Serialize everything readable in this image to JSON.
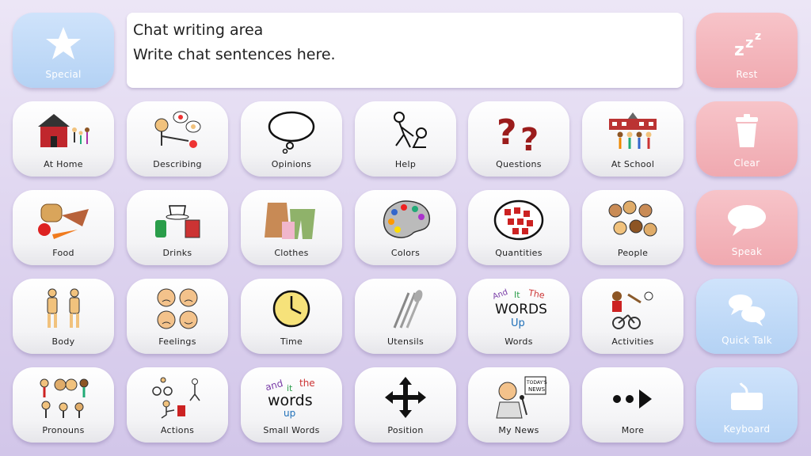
{
  "chat": {
    "line1": "Chat writing area",
    "line2": "Write chat sentences here."
  },
  "left": {
    "special": {
      "label": "Special",
      "icon": "star-icon"
    }
  },
  "right": {
    "rest": {
      "label": "Rest",
      "icon": "zzz-icon"
    },
    "clear": {
      "label": "Clear",
      "icon": "trash-icon"
    },
    "speak": {
      "label": "Speak",
      "icon": "speech-bubble-icon"
    },
    "quick_talk": {
      "label": "Quick Talk",
      "icon": "chat-bubbles-icon"
    },
    "keyboard": {
      "label": "Keyboard",
      "icon": "keyboard-icon"
    }
  },
  "grid": [
    {
      "label": "At Home",
      "icon": "home-family-icon"
    },
    {
      "label": "Describing",
      "icon": "describing-icon"
    },
    {
      "label": "Opinions",
      "icon": "thought-bubble-icon"
    },
    {
      "label": "Help",
      "icon": "help-people-icon"
    },
    {
      "label": "Questions",
      "icon": "question-marks-icon"
    },
    {
      "label": "At School",
      "icon": "school-icon"
    },
    {
      "label": "Food",
      "icon": "food-icon"
    },
    {
      "label": "Drinks",
      "icon": "drinks-icon"
    },
    {
      "label": "Clothes",
      "icon": "clothes-icon"
    },
    {
      "label": "Colors",
      "icon": "palette-icon"
    },
    {
      "label": "Quantities",
      "icon": "quantities-icon"
    },
    {
      "label": "People",
      "icon": "people-faces-icon"
    },
    {
      "label": "Body",
      "icon": "body-icon"
    },
    {
      "label": "Feelings",
      "icon": "feelings-faces-icon"
    },
    {
      "label": "Time",
      "icon": "clock-icon"
    },
    {
      "label": "Utensils",
      "icon": "utensils-icon"
    },
    {
      "label": "Words",
      "icon": "words-icon"
    },
    {
      "label": "Activities",
      "icon": "activities-icon"
    },
    {
      "label": "Pronouns",
      "icon": "pronouns-icon"
    },
    {
      "label": "Actions",
      "icon": "actions-icon"
    },
    {
      "label": "Small Words",
      "icon": "small-words-icon"
    },
    {
      "label": "Position",
      "icon": "move-arrows-icon"
    },
    {
      "label": "My News",
      "icon": "news-reader-icon"
    },
    {
      "label": "More",
      "icon": "more-arrow-icon"
    }
  ],
  "words_tile_text": {
    "and": "And",
    "it": "It",
    "the": "The",
    "words": "WORDS",
    "up": "Up"
  },
  "small_words_tile_text": {
    "and": "and",
    "it": "it",
    "the": "the",
    "words": "words",
    "up": "up"
  },
  "news_sign": {
    "line1": "TODAY'S",
    "line2": "NEWS"
  },
  "colors": {
    "blue_button": "#b4d2f4",
    "pink_button": "#f0a9b0",
    "background": "#ddd3ef"
  }
}
